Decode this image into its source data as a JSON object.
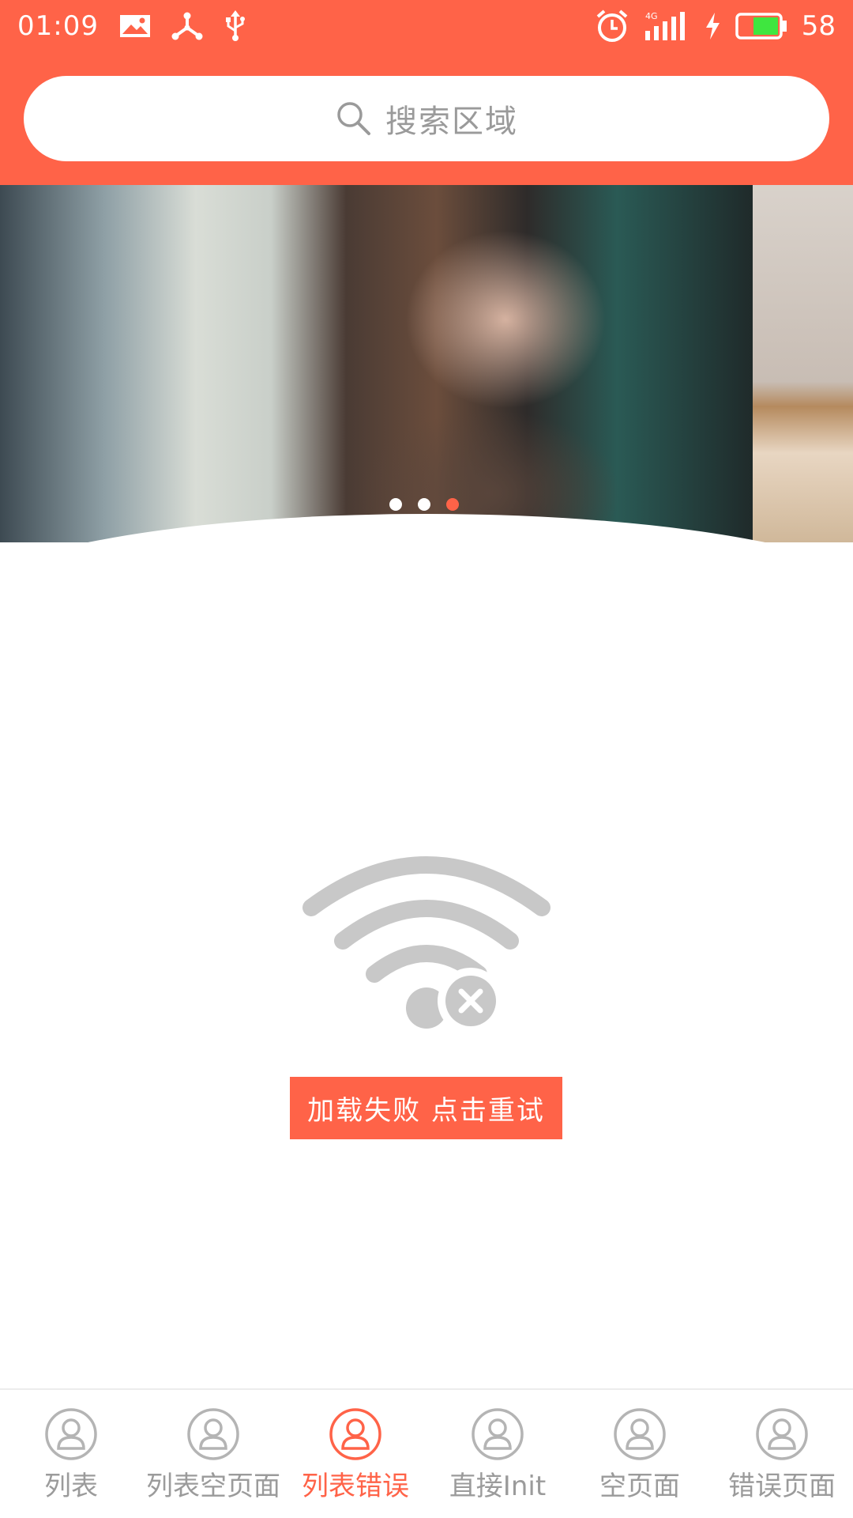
{
  "status_bar": {
    "time": "01:09",
    "battery": "58",
    "network": "4G",
    "icons": [
      "image-icon",
      "share-icon",
      "usb-icon",
      "alarm-icon",
      "signal-icon",
      "charging-icon",
      "battery-icon"
    ]
  },
  "search": {
    "placeholder": "搜索区域"
  },
  "banner": {
    "dot_count": 3,
    "active_dot_index": 2
  },
  "error_state": {
    "icon": "wifi-off-icon",
    "retry_label": "加载失败 点击重试"
  },
  "bottom_nav": {
    "items": [
      {
        "label": "列表",
        "icon": "user-icon",
        "active": false
      },
      {
        "label": "列表空页面",
        "icon": "user-icon",
        "active": false
      },
      {
        "label": "列表错误",
        "icon": "user-icon",
        "active": true
      },
      {
        "label": "直接Init",
        "icon": "user-icon",
        "active": false
      },
      {
        "label": "空页面",
        "icon": "user-icon",
        "active": false
      },
      {
        "label": "错误页面",
        "icon": "user-icon",
        "active": false
      }
    ]
  },
  "colors": {
    "accent": "#FF6348",
    "inactive_text": "#9B9B9B",
    "icon_gray": "#C8C8C8",
    "background": "#FFFFFF"
  }
}
